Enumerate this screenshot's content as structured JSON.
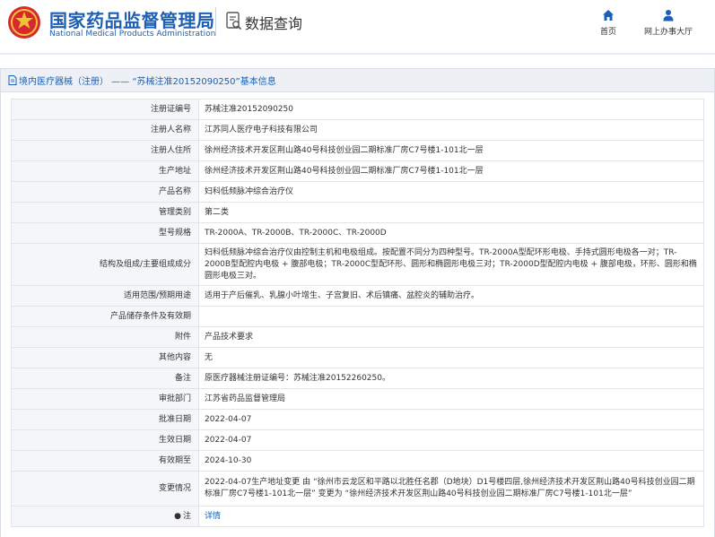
{
  "header": {
    "site_title": "国家药品监督管理局",
    "site_subtitle": "National Medical Products Administration",
    "query_title": "数据查询",
    "nav": {
      "home_label": "首页",
      "hall_label": "网上办事大厅"
    }
  },
  "panel": {
    "title": "境内医疗器械（注册） —— “苏械注准20152090250”基本信息"
  },
  "details": [
    {
      "label": "注册证编号",
      "value": "苏械注准20152090250"
    },
    {
      "label": "注册人名称",
      "value": "江苏同人医疗电子科技有限公司"
    },
    {
      "label": "注册人住所",
      "value": "徐州经济技术开发区荆山路40号科技创业园二期标准厂房C7号楼1-101北一层"
    },
    {
      "label": "生产地址",
      "value": "徐州经济技术开发区荆山路40号科技创业园二期标准厂房C7号楼1-101北一层"
    },
    {
      "label": "产品名称",
      "value": "妇科低频脉冲综合治疗仪"
    },
    {
      "label": "管理类别",
      "value": "第二类"
    },
    {
      "label": "型号规格",
      "value": "TR-2000A、TR-2000B、TR-2000C、TR-2000D"
    },
    {
      "label": "结构及组成/主要组成成分",
      "value": "妇科低频脉冲综合治疗仪由控制主机和电极组成。按配置不同分为四种型号。TR-2000A型配环形电极、手持式圆形电极各一对；TR-2000B型配腔内电极 + 腹部电极；TR-2000C型配环形、圆形和椭圆形电极三对；TR-2000D型配腔内电极 + 腹部电极，环形、圆形和椭圆形电极三对。"
    },
    {
      "label": "适用范围/预期用途",
      "value": "适用于产后催乳、乳腺小叶增生、子宫复旧、术后镇痛、盆腔炎的辅助治疗。"
    },
    {
      "label": "产品储存条件及有效期",
      "value": ""
    },
    {
      "label": "附件",
      "value": "产品技术要求"
    },
    {
      "label": "其他内容",
      "value": "无"
    },
    {
      "label": "备注",
      "value": "原医疗器械注册证编号：苏械注准20152260250。"
    },
    {
      "label": "审批部门",
      "value": "江苏省药品监督管理局"
    },
    {
      "label": "批准日期",
      "value": "2022-04-07"
    },
    {
      "label": "生效日期",
      "value": "2022-04-07"
    },
    {
      "label": "有效期至",
      "value": "2024-10-30"
    },
    {
      "label": "变更情况",
      "value": "2022-04-07生产地址变更 由 “徐州市云龙区和平路以北胜任名郡（D地块）D1号楼四层,徐州经济技术开发区荆山路40号科技创业园二期标准厂房C7号楼1-101北一层” 变更为 “徐州经济技术开发区荆山路40号科技创业园二期标准厂房C7号楼1-101北一层”"
    },
    {
      "label": "注",
      "value": "详情"
    }
  ],
  "colors": {
    "brand_blue": "#1c5fb4",
    "logo_red": "#d7282f",
    "logo_gold": "#f2c13b",
    "label_bg": "#f4f6f9",
    "panel_head_bg": "#edf1f6"
  },
  "icons": {
    "logo": "nmpa-emblem",
    "query": "document-search-icon",
    "home": "home-icon",
    "hall": "user-icon",
    "panel_head": "document-icon",
    "note": "pin-icon"
  }
}
